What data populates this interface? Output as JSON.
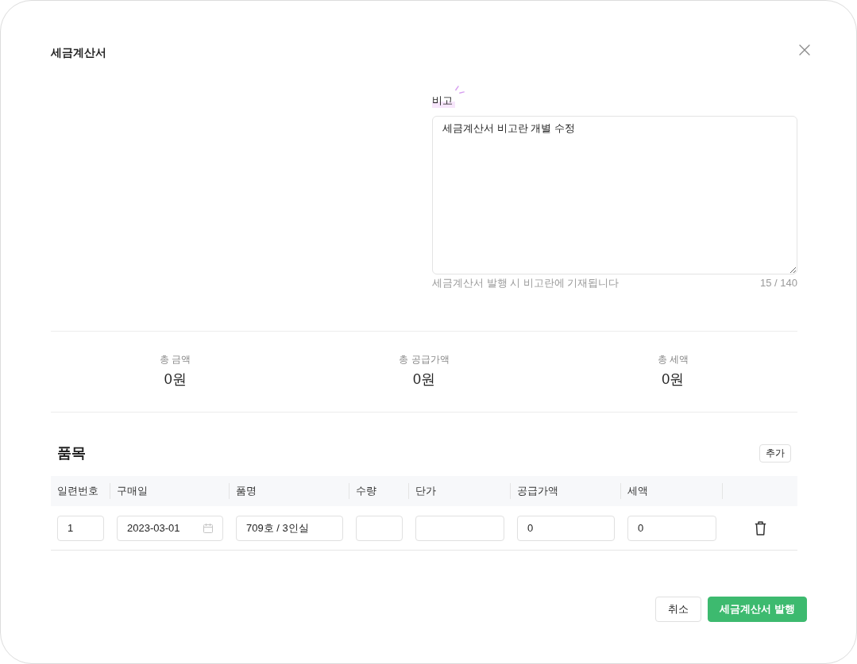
{
  "dialog": {
    "title": "세금계산서"
  },
  "memo": {
    "label": "비고",
    "value": "세금계산서 비고란 개별 수정",
    "hint": "세금계산서 발행 시 비고란에 기재됩니다",
    "counter": "15 / 140"
  },
  "totals": [
    {
      "label": "총 금액",
      "value": "0원"
    },
    {
      "label": "총 공급가액",
      "value": "0원"
    },
    {
      "label": "총 세액",
      "value": "0원"
    }
  ],
  "items": {
    "title": "품목",
    "add_button": "추가",
    "columns": [
      "일련번호",
      "구매일",
      "품명",
      "수량",
      "단가",
      "공급가액",
      "세액"
    ],
    "rows": [
      {
        "serial": "1",
        "purchase_date": "2023-03-01",
        "item_name": "709호 / 3인실",
        "supply_amount": "0",
        "tax": "0"
      }
    ]
  },
  "actions": [
    {
      "label": "취소",
      "kind": "secondary"
    },
    {
      "label": "세금계산서 발행",
      "kind": "primary"
    }
  ]
}
